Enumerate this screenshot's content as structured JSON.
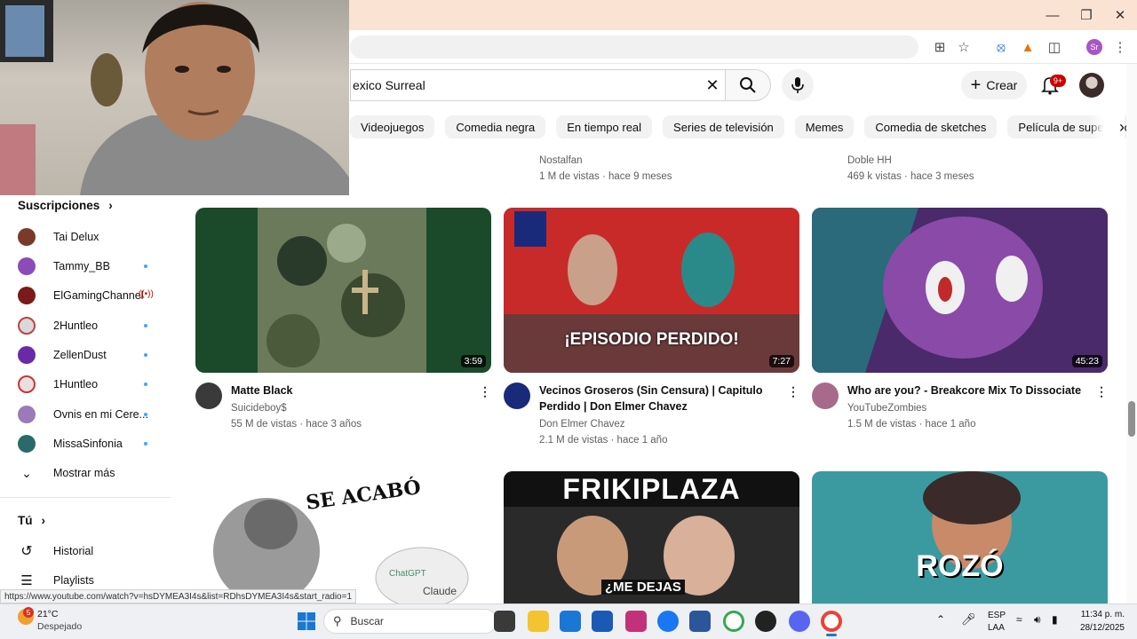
{
  "search": {
    "query": "exico Surreal"
  },
  "header": {
    "create_label": "Crear",
    "notif_badge": "9+"
  },
  "chips": [
    "Videojuegos",
    "Comedia negra",
    "En tiempo real",
    "Series de televisión",
    "Memes",
    "Comedia de sketches",
    "Película de superhéroes"
  ],
  "top_row": [
    {
      "channel": "Nostalfan",
      "meta": "1 M de vistas · hace 9 meses"
    },
    {
      "channel": "Doble HH",
      "meta": "469 k vistas · hace 3 meses"
    }
  ],
  "sidebar": {
    "subs_heading": "Suscripciones",
    "items": [
      {
        "name": "Tai Delux",
        "color": "#7a3a2a",
        "dot": false
      },
      {
        "name": "Tammy_BB",
        "color": "#8c4bb8",
        "dot": true
      },
      {
        "name": "ElGamingChannel",
        "color": "#7a1a1a",
        "dot": false,
        "live": true
      },
      {
        "name": "2Huntleo",
        "color": "#d9d9d9",
        "dot": true
      },
      {
        "name": "ZellenDust",
        "color": "#6a2aa8",
        "dot": true
      },
      {
        "name": "1Huntleo",
        "color": "#e8e0e0",
        "dot": true
      },
      {
        "name": "Ovnis en mi Cere...",
        "color": "#9a7ab8",
        "dot": true
      },
      {
        "name": "MissaSinfonia",
        "color": "#2a6a6a",
        "dot": true
      }
    ],
    "show_more": "Mostrar más",
    "you_heading": "Tú",
    "history": "Historial",
    "playlists": "Playlists"
  },
  "videos": [
    {
      "title1": "Matte Black",
      "title2": "",
      "channel": "Suicideboy$",
      "meta": "55 M de vistas · hace 3 años",
      "duration": "3:59",
      "thumb": "#1a4a2a"
    },
    {
      "title1": "Vecinos Groseros (Sin Censura) | Capitulo",
      "title2": "Perdido | Don Elmer Chavez",
      "channel": "Don Elmer Chavez",
      "meta": "2.1 M de vistas · hace 1 año",
      "duration": "7:27",
      "thumb": "#b81e24",
      "caption": "¡EPISODIO PERDIDO!"
    },
    {
      "title1": "Who are you? - Breakcore Mix To Dissociate",
      "title2": "",
      "channel": "YouTubeZombies",
      "meta": "1.5 M de vistas · hace 1 año",
      "duration": "45:23",
      "thumb": "#5a2a7a"
    }
  ],
  "row2": [
    {
      "caption": "SE ACABÓ",
      "sub1": "ChatGPT",
      "sub2": "Claude"
    },
    {
      "caption": "FRIKIPLAZA",
      "sub1": "¿ME DEJAS"
    },
    {
      "caption": "ROZÓ"
    }
  ],
  "status_url": "https://www.youtube.com/watch?v=hsDYMEA3I4s&list=RDhsDYMEA3I4s&start_radio=1",
  "taskbar": {
    "temp": "21°C",
    "weather": "Despejado",
    "weather_badge": "5",
    "search_placeholder": "Buscar",
    "lang1": "ESP",
    "lang2": "LAA",
    "time": "11:34 p. m.",
    "date": "28/12/2025"
  },
  "profile_initials": "Sr"
}
